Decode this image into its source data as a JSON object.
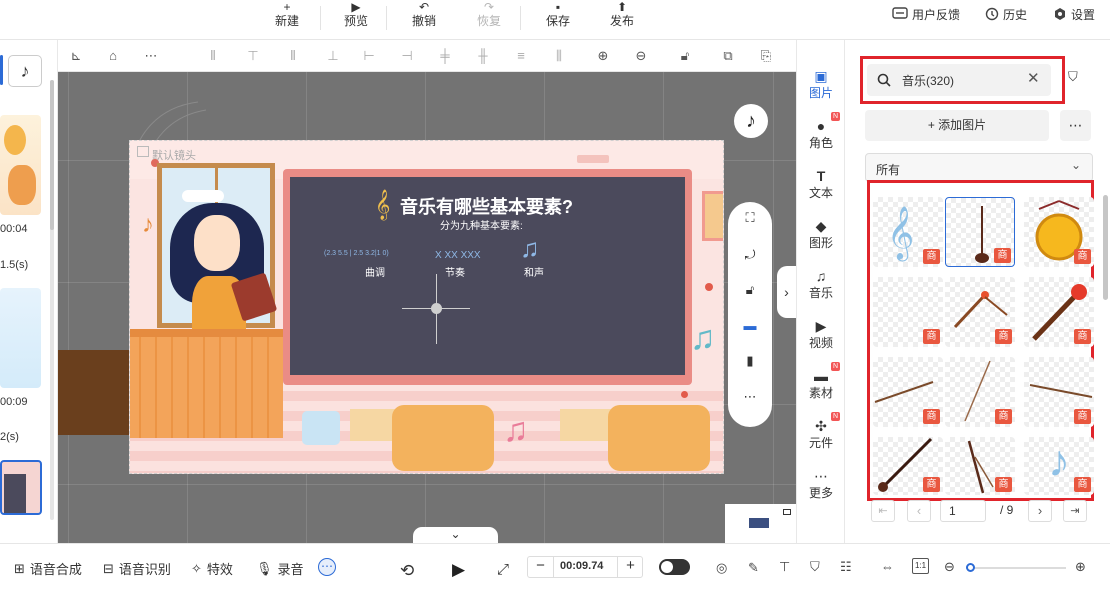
{
  "topbar": {
    "buttons": [
      {
        "label": "新建",
        "icon": "plus-icon",
        "glyph": "+"
      },
      {
        "label": "预览",
        "icon": "play-icon",
        "glyph": "▶"
      },
      {
        "label": "撤销",
        "icon": "undo-icon",
        "glyph": "↶"
      },
      {
        "label": "恢复",
        "icon": "redo-icon",
        "glyph": "↷"
      },
      {
        "label": "保存",
        "icon": "save-icon",
        "glyph": "▪"
      },
      {
        "label": "发布",
        "icon": "publish-icon",
        "glyph": "⬆"
      }
    ],
    "right": {
      "feedback": "用户反馈",
      "history": "历史",
      "settings": "设置"
    }
  },
  "leftstrip": {
    "time1": "00:04",
    "dur1": "1.5(s)",
    "time2": "00:09",
    "dur2": "2(s)"
  },
  "canvas": {
    "default_lens": "默认镜头",
    "slide_title": "音乐有哪些基本要素?",
    "slide_subtitle": "分为九种基本要素:",
    "term1": "曲调",
    "term2": "节奏",
    "term3": "和声",
    "melody_marks": "(2.3  5.5 | 2.5  3.2|1 0)",
    "rhythm_marks": "X  XX  XXX"
  },
  "rightnav": {
    "items": [
      {
        "label": "图片",
        "icon": "image-icon",
        "glyph": "▣",
        "active": true,
        "badge": false
      },
      {
        "label": "角色",
        "icon": "character-icon",
        "glyph": "●",
        "active": false,
        "badge": true
      },
      {
        "label": "文本",
        "icon": "text-icon",
        "glyph": "T",
        "active": false,
        "badge": false
      },
      {
        "label": "图形",
        "icon": "shape-icon",
        "glyph": "◆",
        "active": false,
        "badge": false
      },
      {
        "label": "音乐",
        "icon": "music-icon",
        "glyph": "♫",
        "active": false,
        "badge": false
      },
      {
        "label": "视频",
        "icon": "video-icon",
        "glyph": "▶",
        "active": false,
        "badge": false
      },
      {
        "label": "素材",
        "icon": "folder-icon",
        "glyph": "▬",
        "active": false,
        "badge": true
      },
      {
        "label": "元件",
        "icon": "component-icon",
        "glyph": "✣",
        "active": false,
        "badge": true
      },
      {
        "label": "更多",
        "icon": "more-icon",
        "glyph": "⋯",
        "active": false,
        "badge": false
      }
    ],
    "badge_text": "N"
  },
  "panel": {
    "search_value": "音乐(320)",
    "add_image": "添加图片",
    "filter": "所有",
    "asset_badge": "商",
    "pagination": {
      "current": "1",
      "total": "/ 9"
    }
  },
  "bottombar": {
    "tts": "语音合成",
    "asr": "语音识别",
    "effects": "特效",
    "record": "录音",
    "time": "00:09.74"
  },
  "colors": {
    "accent": "#2c6bd6",
    "highlight": "#e0242b",
    "badge": "#e9573f",
    "chalkboard": "#4b4a5c"
  }
}
